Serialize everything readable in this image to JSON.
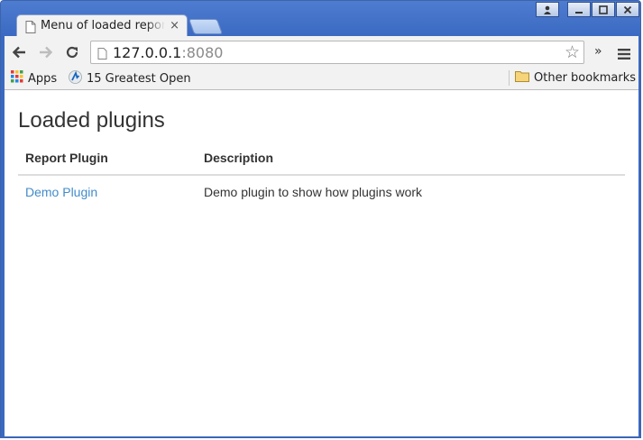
{
  "browser": {
    "tab_title": "Menu of loaded reports",
    "tab_close": "×",
    "url_host": "127.0.0.1",
    "url_port": ":8080",
    "overflow": "»"
  },
  "bookmarks": {
    "apps_label": "Apps",
    "item1_label": "15 Greatest Open",
    "other_label": "Other bookmarks"
  },
  "page": {
    "heading": "Loaded plugins",
    "table": {
      "headers": [
        "Report Plugin",
        "Description"
      ],
      "rows": [
        {
          "plugin": "Demo Plugin",
          "description": "Demo plugin to show how plugins work"
        }
      ]
    }
  },
  "colors": {
    "link": "#428bca",
    "frame": "#3a69c2"
  }
}
